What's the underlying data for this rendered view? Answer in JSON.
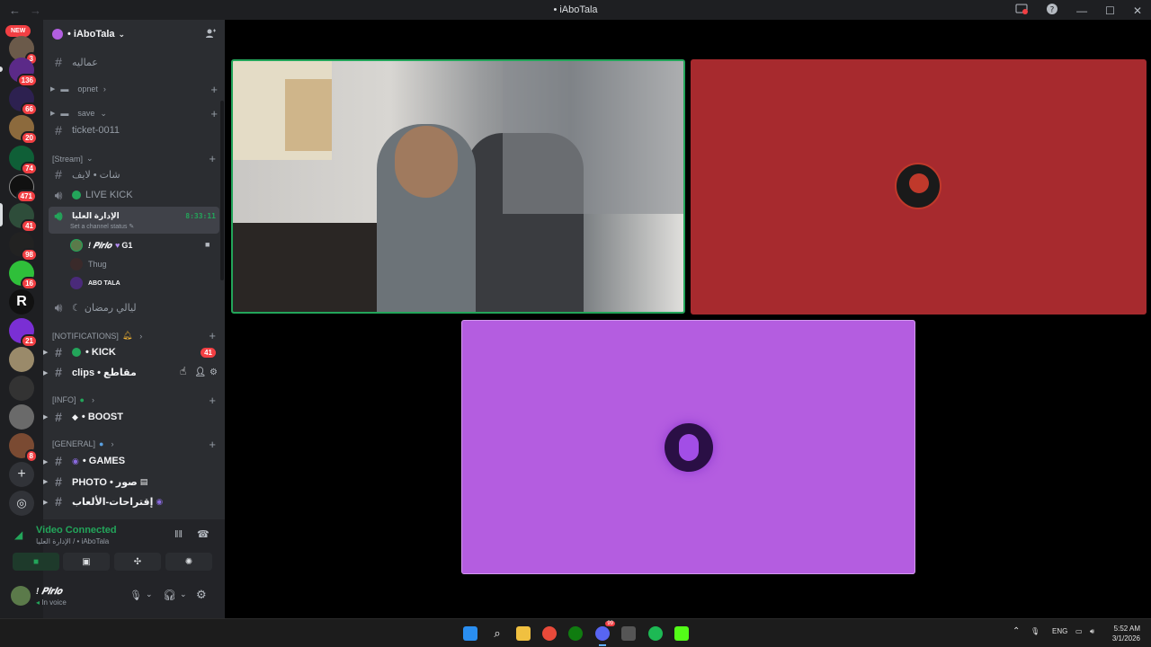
{
  "window": {
    "title": "• iAboTala"
  },
  "rail": {
    "new_label": "NEW",
    "top_count": "387",
    "badges": [
      "3",
      "136",
      "66",
      "20",
      "74",
      "471",
      "41",
      "98",
      "16",
      "21",
      "8"
    ]
  },
  "server": {
    "name": "• iAboTala"
  },
  "channels": {
    "top": [
      {
        "name": "عماليه"
      },
      {
        "name": "opnet"
      },
      {
        "name": "save"
      },
      {
        "name": "ticket-0011"
      }
    ],
    "stream_category": "[Stream]",
    "stream_channels": [
      {
        "name": "شات • لايف"
      },
      {
        "name": "LIVE KICK"
      }
    ],
    "active_voice": {
      "name": "الإدارة العليا",
      "timer": "8:33:11",
      "status_hint": "Set a channel status"
    },
    "voice_users": [
      {
        "name": "! 𝑷𝒊𝒓𝒍𝒐",
        "tag": "G1"
      },
      {
        "name": "Thug"
      },
      {
        "name": "ABO TALA"
      }
    ],
    "ramadan": "ليالي رمضان",
    "notif_category": "[NOTIFICATIONS]",
    "notif_channels": [
      {
        "name": "• KICK",
        "badge": "41"
      },
      {
        "name": "clips • مقاطع"
      }
    ],
    "info_category": "[INFO]",
    "info_channels": [
      {
        "name": "• BOOST"
      }
    ],
    "general_category": "[GENERAL]",
    "general_channels": [
      {
        "name": "• GAMES"
      },
      {
        "name": "PHOTO • صور"
      },
      {
        "name": "إقتراحات-الألعاب"
      }
    ]
  },
  "voice_panel": {
    "status": "Video Connected",
    "location": "الإدارة العليا / • iAboTala"
  },
  "user_panel": {
    "name": "! 𝑷𝒊𝒓𝒍𝒐",
    "status": "In voice"
  },
  "taskbar": {
    "lang": "ENG",
    "time": "5:52 AM",
    "date": "3/1/2026",
    "discord_badge": "99"
  },
  "colors": {
    "accent_green": "#23a55a",
    "red_tile": "#a72a2e",
    "purple_tile": "#b45de0",
    "badge_red": "#f23f43"
  }
}
